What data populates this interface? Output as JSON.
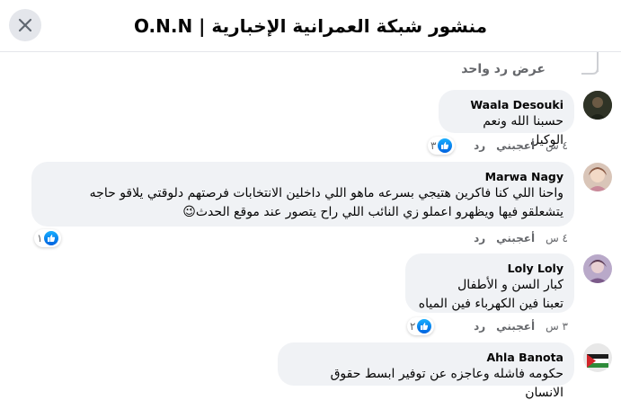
{
  "header": {
    "title": "منشور شبكة العمرانية الإخبارية | O.N.N"
  },
  "thread": {
    "view_reply": "عرض رد واحد"
  },
  "comments": [
    {
      "author": "Waala Desouki",
      "lines": [
        "حسبنا الله ونعم الوكيل"
      ],
      "time": "٤ س",
      "like": "أعجبني",
      "reply": "رد",
      "reactions": "٣"
    },
    {
      "author": "Marwa Nagy",
      "lines": [
        "واحنا اللي كنا فاكرين هتيجي بسرعه ماهو اللي داخلين الانتخابات فرصتهم دلوقتي يلاقو حاجه",
        "يتشعلقو فيها ويظهرو اعملو زي النائب اللي راح يتصور عند موقع الحدث😉"
      ],
      "time": "٤ س",
      "like": "أعجبني",
      "reply": "رد",
      "reactions": "١"
    },
    {
      "author": "Loly Loly",
      "lines": [
        "كبار السن و الأطفال",
        "تعبنا فين الكهرباء فين المياه"
      ],
      "time": "٣ س",
      "like": "أعجبني",
      "reply": "رد",
      "reactions": "٢"
    },
    {
      "author": "Ahla Banota",
      "lines": [
        "حكومه فاشله وعاجزه عن توفير ابسط حقوق الانسان"
      ]
    }
  ]
}
